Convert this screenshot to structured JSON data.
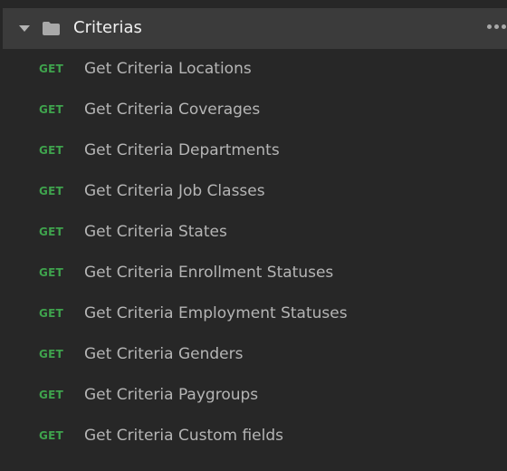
{
  "folder": {
    "name": "Criterias",
    "caret_icon": "caret-down-icon",
    "folder_icon": "folder-icon",
    "more_icon": "more-horizontal-icon"
  },
  "colors": {
    "background": "#272727",
    "header_background": "#3b3b3b",
    "method_get": "#3fa34d",
    "item_text": "#b5b5b5",
    "folder_text": "#f0f0f0"
  },
  "requests": [
    {
      "method": "GET",
      "name": "Get Criteria Locations"
    },
    {
      "method": "GET",
      "name": "Get Criteria Coverages"
    },
    {
      "method": "GET",
      "name": "Get Criteria Departments"
    },
    {
      "method": "GET",
      "name": "Get Criteria Job Classes"
    },
    {
      "method": "GET",
      "name": "Get Criteria States"
    },
    {
      "method": "GET",
      "name": "Get Criteria Enrollment Statuses"
    },
    {
      "method": "GET",
      "name": "Get Criteria Employment Statuses"
    },
    {
      "method": "GET",
      "name": "Get Criteria Genders"
    },
    {
      "method": "GET",
      "name": "Get Criteria Paygroups"
    },
    {
      "method": "GET",
      "name": "Get Criteria Custom fields"
    }
  ]
}
